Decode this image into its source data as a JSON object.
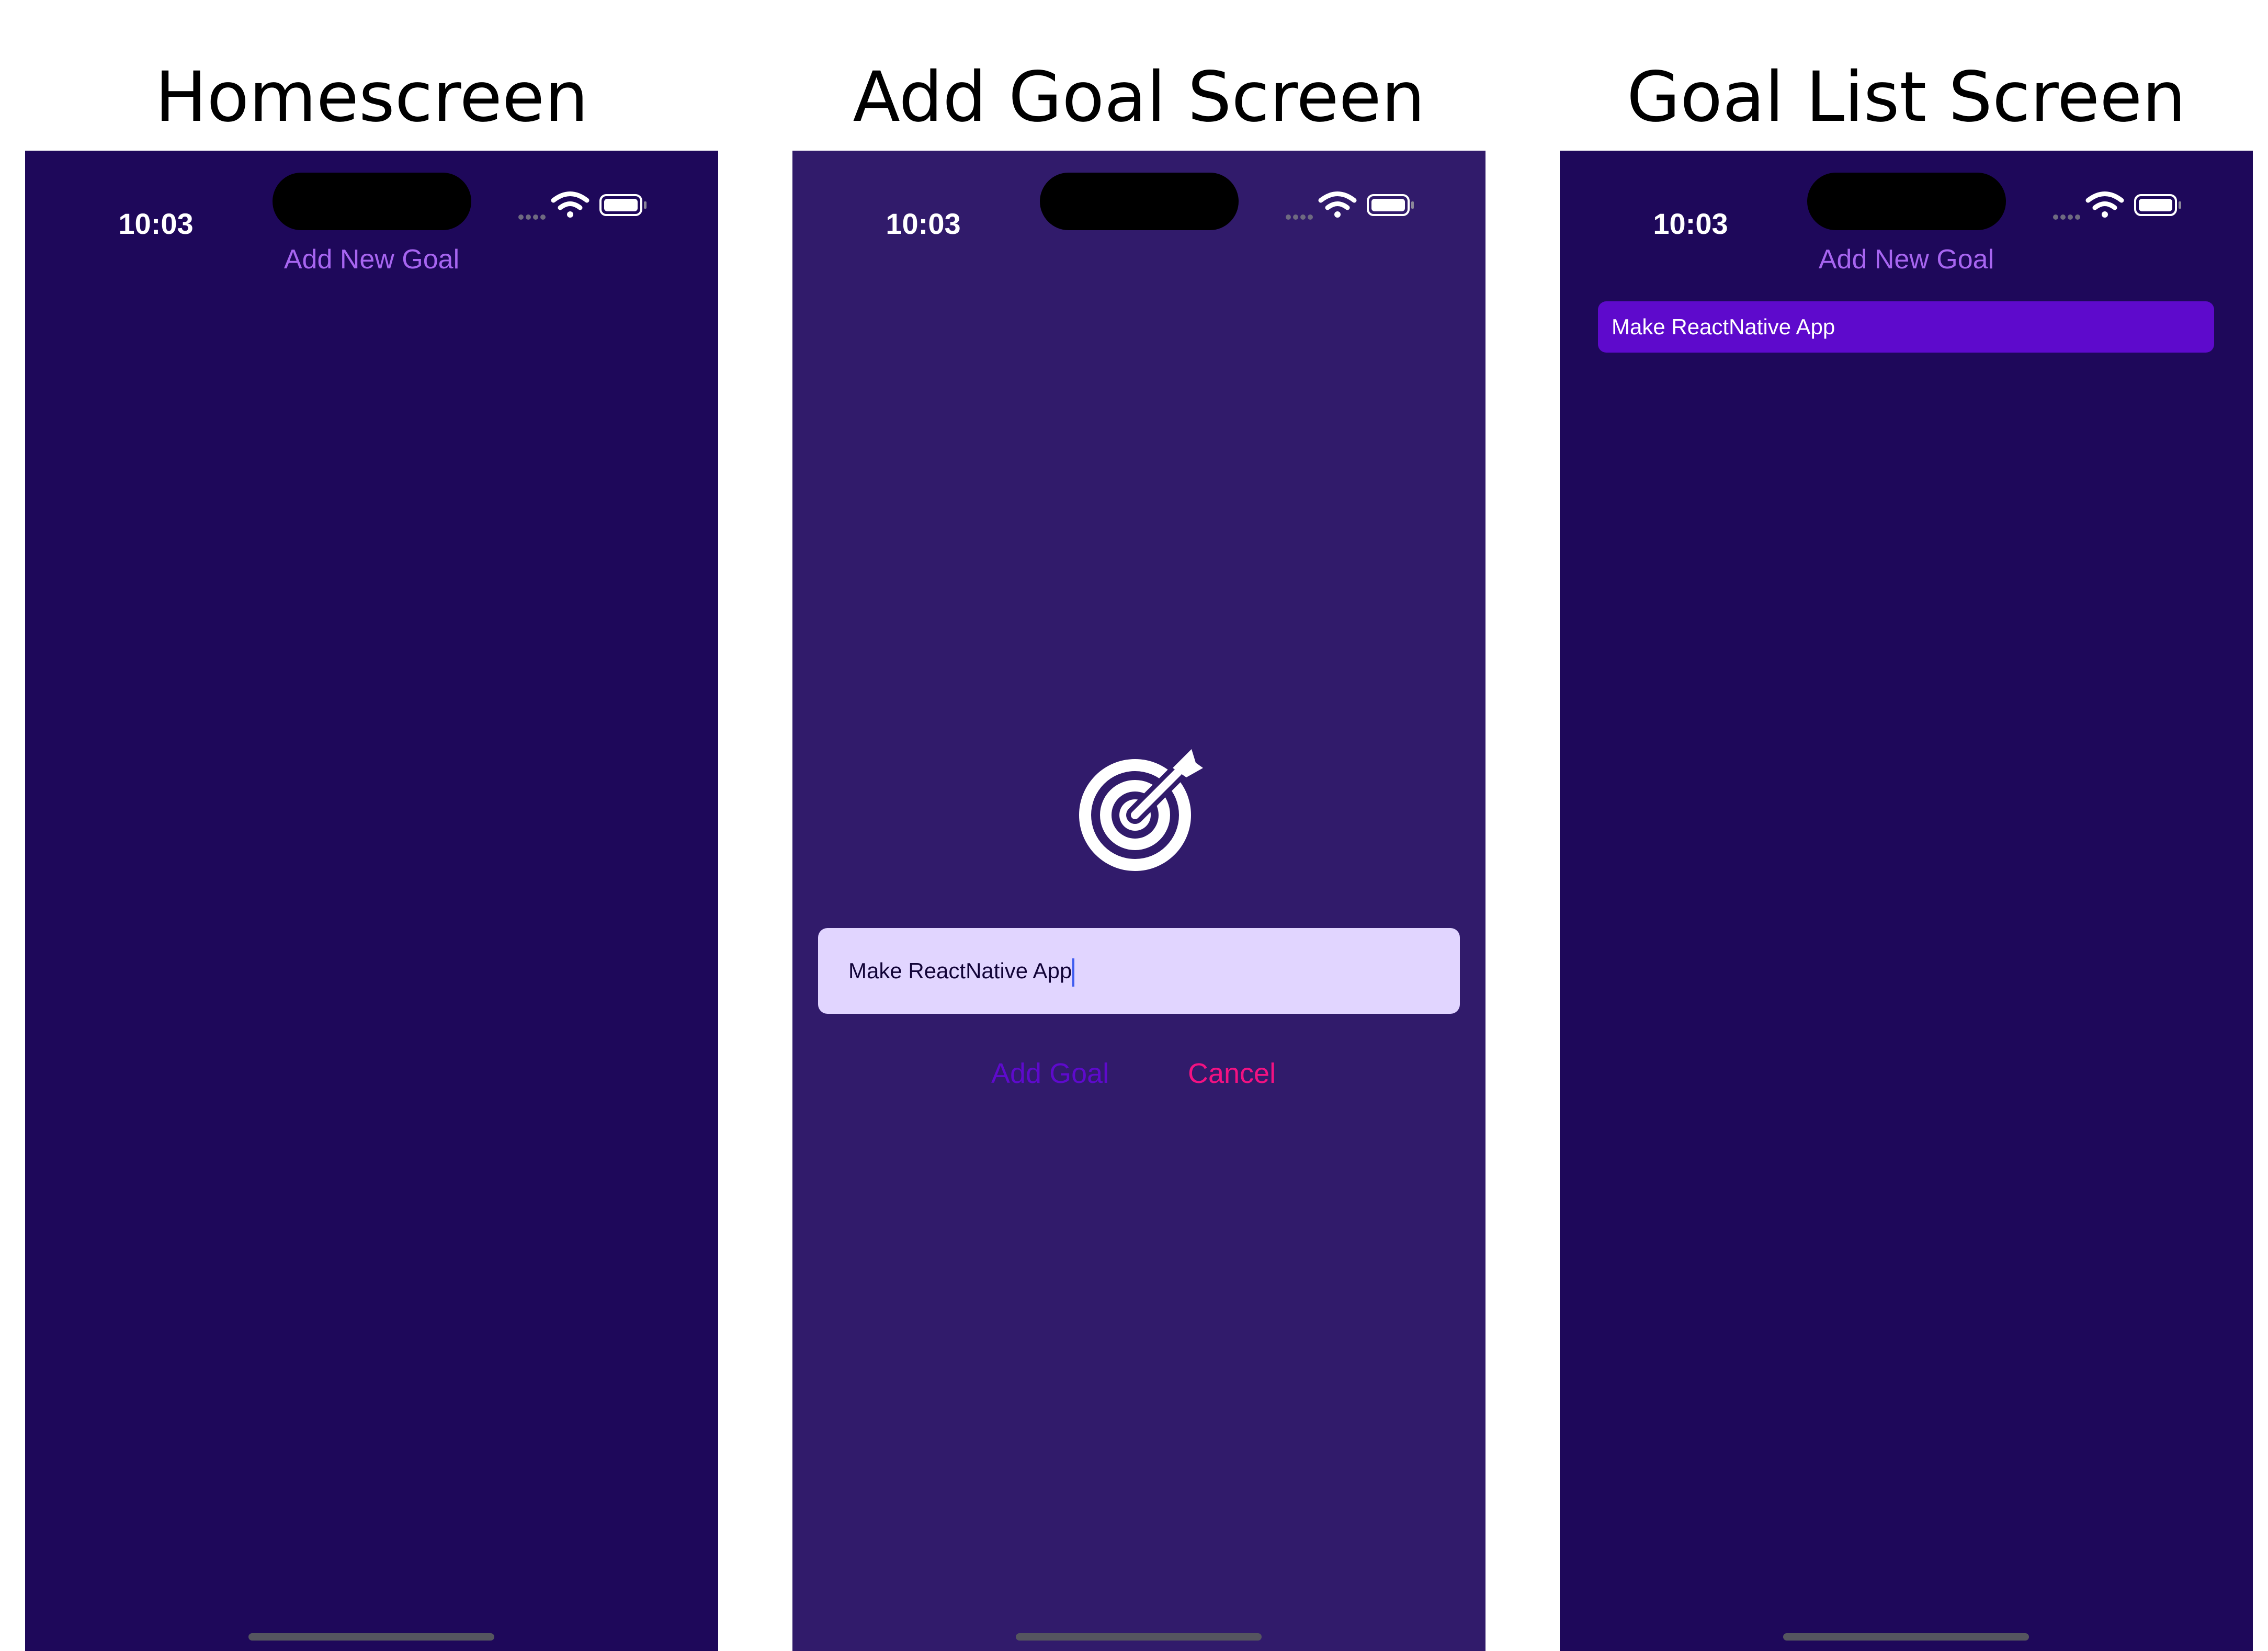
{
  "colors": {
    "page_background": "#ffffff",
    "phone_background_main": "#1e085a",
    "phone_background_modal": "#311b6b",
    "link_purple": "#a765f0",
    "goal_item_background": "#5e0acc",
    "input_background": "#e1d5ff",
    "add_goal_text": "#5e0acc",
    "cancel_text": "#f31282",
    "icon_color": "#ffffff"
  },
  "status_bar": {
    "time": "10:03",
    "signal_icon": "cellular-dots-icon",
    "wifi_icon": "wifi-icon",
    "battery_icon": "battery-icon"
  },
  "panels": {
    "home": {
      "title": "Homescreen",
      "add_new_goal_label": "Add New Goal"
    },
    "add_goal": {
      "title": "Add Goal Screen",
      "goal_icon": "target-arrow-icon",
      "input_value": "Make ReactNative App",
      "add_goal_label": "Add Goal",
      "cancel_label": "Cancel"
    },
    "goal_list": {
      "title": "Goal List Screen",
      "add_new_goal_label": "Add New Goal",
      "goals": [
        "Make ReactNative App"
      ]
    }
  }
}
